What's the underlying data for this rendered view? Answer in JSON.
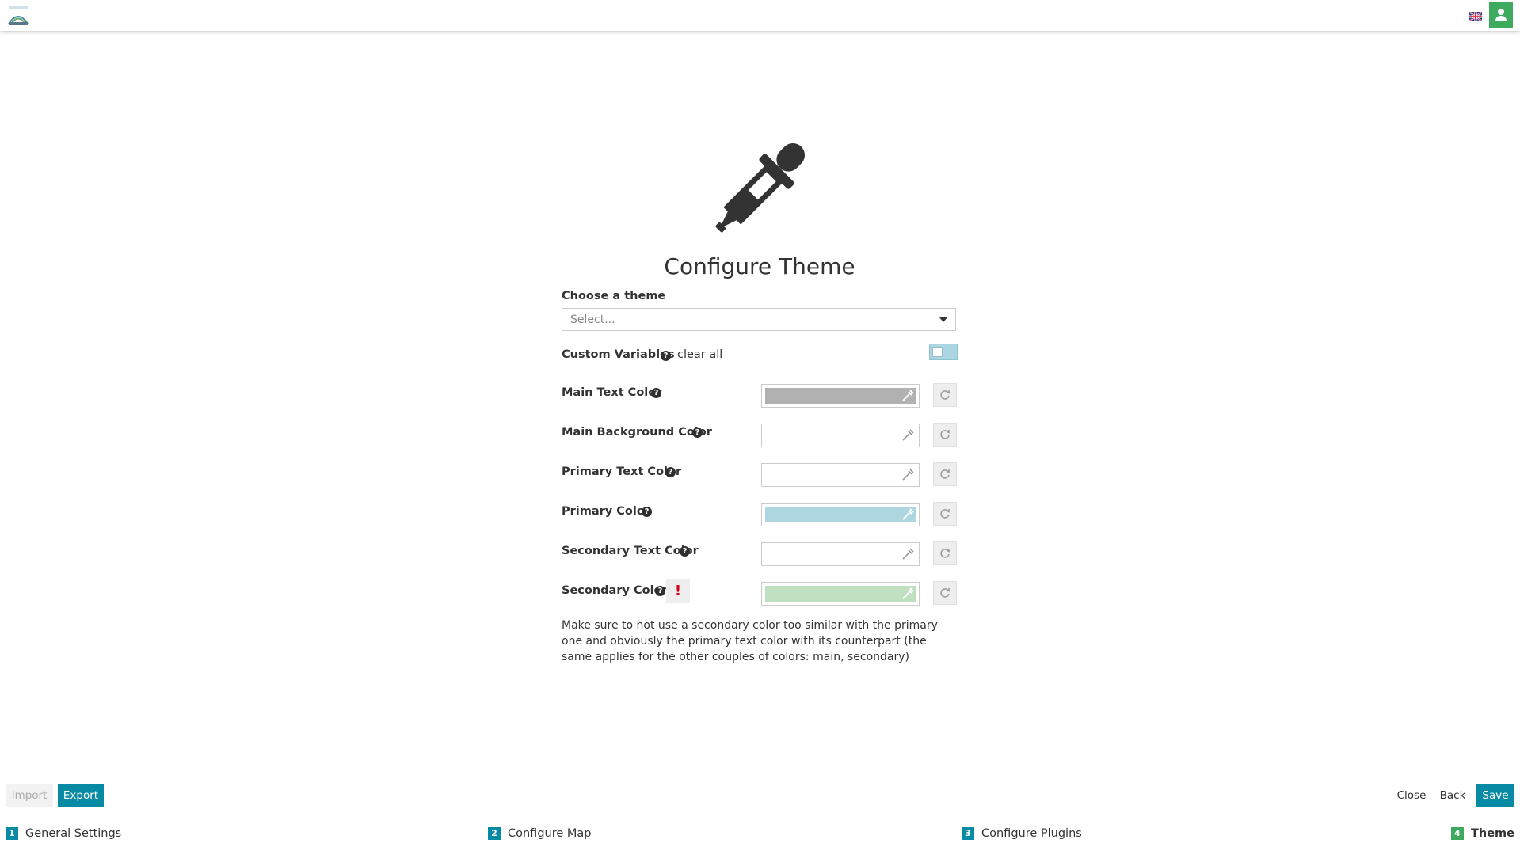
{
  "header": {
    "logo_icon": "mapstore-logo-icon",
    "language_icon": "uk-flag-icon",
    "user_icon": "user-icon",
    "user_button_color": "#3eaa5e"
  },
  "main": {
    "hero_icon": "eyedropper-icon",
    "title": "Configure Theme",
    "theme_select": {
      "label": "Choose a theme",
      "placeholder": "Select..."
    },
    "custom_variables": {
      "label": "Custom Variables",
      "clear_all": "clear all",
      "toggle_on": false
    },
    "color_rows": [
      {
        "label": "Main Text Color",
        "swatch": "#b1b1b1"
      },
      {
        "label": "Main Background Color",
        "swatch": null
      },
      {
        "label": "Primary Text Color",
        "swatch": null
      },
      {
        "label": "Primary Color",
        "swatch": "#aed6e1"
      },
      {
        "label": "Secondary Text Color",
        "swatch": null
      },
      {
        "label": "Secondary Color",
        "swatch": "#c0e0c1",
        "warning": "!"
      }
    ],
    "note": "Make sure to not use a secondary color too similar with the primary one and obviously the primary text color with its counterpart (the same applies for the other couples of colors: main, secondary)"
  },
  "footer": {
    "import_label": "Import",
    "export_label": "Export",
    "close_label": "Close",
    "back_label": "Back",
    "save_label": "Save",
    "accent_color": "#078aa3",
    "steps": [
      {
        "num": "1",
        "label": "General Settings"
      },
      {
        "num": "2",
        "label": "Configure Map"
      },
      {
        "num": "3",
        "label": "Configure Plugins"
      },
      {
        "num": "4",
        "label": "Theme",
        "active": true
      }
    ]
  }
}
